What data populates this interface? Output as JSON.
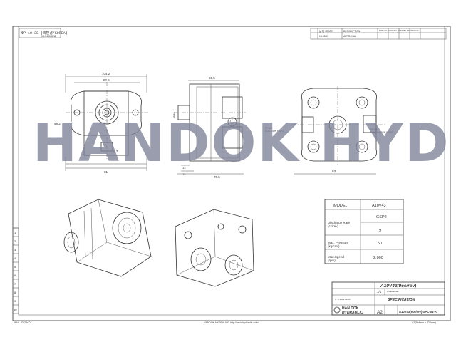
{
  "header": {
    "left_code": "ФР-10-38-(리번경/KOREA)",
    "left_sub": "08-3463-8-11",
    "rev_date_label": "날 짜 / DATE",
    "rev_desc_label": "DESCRIPTION",
    "rev_date": "13.08.05",
    "rev_desc": "APPROVAL",
    "rev_columns": "DWG BY  CHK'D BY  APP'D BY  REVISION No."
  },
  "dimensions": {
    "front_width": "104.2",
    "front_inner": "82.5",
    "front_height": "48.2",
    "front_bottom": "81",
    "port_small": "6.3",
    "side_top": "55.5",
    "side_h1": "Φ40",
    "side_b1": "13",
    "side_b2": "15",
    "side_bottom": "75.5",
    "rear_bottom": "93",
    "suction_label": "PF3/4\nSUCTION PORT",
    "discharge_label": "PF3/4\nDISCHARGE PORT"
  },
  "watermark": "HANDOK HYD",
  "spec_table": {
    "header": [
      "MODEL",
      "A10V43"
    ],
    "rows": [
      [
        "Discharge Rate\n(cc/rev)",
        "GSP2"
      ],
      [
        "",
        "9"
      ],
      [
        "Max. Pressure\n(kg/cm²)",
        "50"
      ],
      [
        "Max.Speed\n(rpm)",
        "2,000"
      ]
    ]
  },
  "title_block": {
    "title": "A10V43(9cc/rev)",
    "scale": "1/1",
    "subtitle": "SPECIFICATION",
    "company_ko": "HAN DOK",
    "company_en": "HYDRAULIC",
    "size": "A2",
    "dwg_no": "A10V43(9cc/rev)-SPC-01-A",
    "date_line": "3. 1/ 2013.08.05",
    "rev_small": "1 RELEASE",
    "sheet": "A2(594mm × 420mm)"
  },
  "footer": {
    "left": "WH1-83-TW-07",
    "center": "HANDOK HYDRAULIC  http://www.hydraulic.co.kr",
    "right": "A2(594mm × 420mm)"
  },
  "margin_numbers": [
    "1",
    "2",
    "3",
    "4",
    "5",
    "6",
    "7",
    "8",
    "9",
    "10"
  ]
}
